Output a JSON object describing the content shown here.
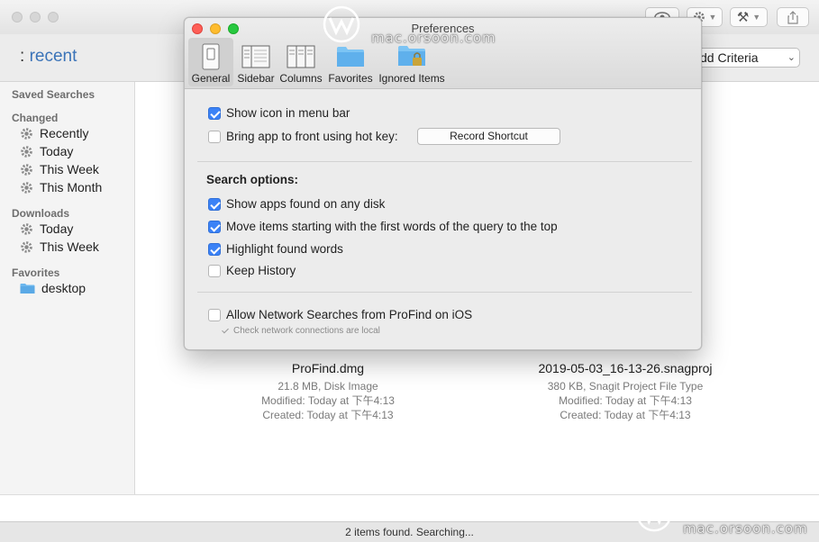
{
  "window": {
    "path_prefix": ":",
    "path_name": "recent",
    "criteria_select": "dd Criteria",
    "status": "2 items found. Searching..."
  },
  "sidebar": {
    "saved_searches": "Saved Searches",
    "changed": {
      "heading": "Changed",
      "items": [
        "Recently",
        "Today",
        "This Week",
        "This Month"
      ]
    },
    "downloads": {
      "heading": "Downloads",
      "items": [
        "Today",
        "This Week"
      ]
    },
    "favorites": {
      "heading": "Favorites",
      "items": [
        "desktop"
      ]
    }
  },
  "files": [
    {
      "name": "ProFind.dmg",
      "info": "21.8 MB, Disk Image",
      "modified": "Modified: Today at 下午4:13",
      "created": "Created: Today at 下午4:13"
    },
    {
      "name": "2019-05-03_16-13-26.snagproj",
      "info": "380 KB, Snagit Project File Type",
      "modified": "Modified: Today at 下午4:13",
      "created": "Created: Today at 下午4:13"
    }
  ],
  "prefs": {
    "title": "Preferences",
    "tabs": [
      "General",
      "Sidebar",
      "Columns",
      "Favorites",
      "Ignored Items"
    ],
    "selected_tab": "General",
    "show_icon_menu_bar": "Show icon in menu bar",
    "bring_to_front": "Bring app to front using hot key:",
    "record_shortcut": "Record Shortcut",
    "search_options": "Search options:",
    "show_apps_any_disk": "Show apps found on any disk",
    "move_items_top": "Move items starting with the first words of the query to the top",
    "highlight_words": "Highlight found words",
    "keep_history": "Keep History",
    "allow_network": "Allow Network Searches from ProFind on iOS",
    "check_network_local": "Check network connections are local"
  },
  "watermark": {
    "site": "mac.orsoon.com"
  },
  "colors": {
    "accent": "#3a73b8",
    "checkbox_on": "#3b82f6",
    "folder": "#6cb7ee"
  }
}
